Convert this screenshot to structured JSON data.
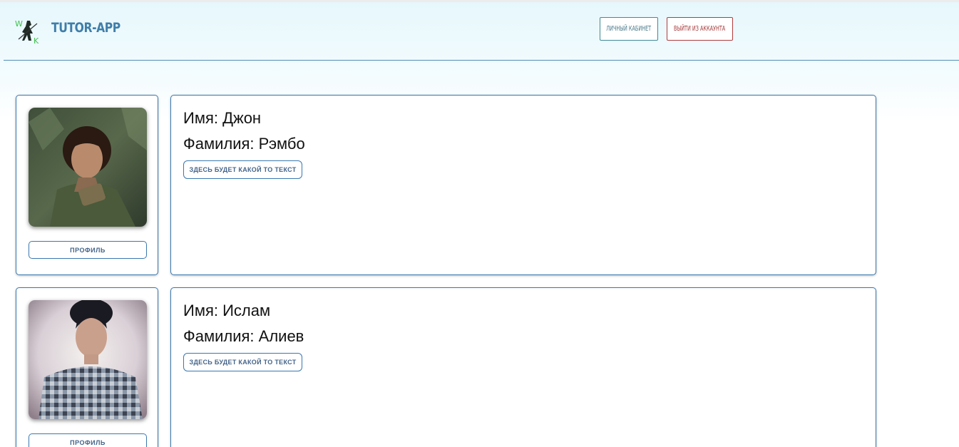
{
  "header": {
    "app_title": "TUTOR-APP",
    "logo_letters": [
      "W",
      "K"
    ],
    "cabinet_label": "Личный кабинет",
    "logout_label": "Выйти из аккаунта"
  },
  "colors": {
    "accent": "#3a78b0",
    "title": "#3f7ea9",
    "logout": "#b23b3b",
    "logo_green": "#3cc24a"
  },
  "tutors": [
    {
      "first_name_line": "Имя: Джон",
      "last_name_line": "Фамилия: Рэмбо",
      "info_button": "Здесь будет какой то текст",
      "profile_button": "Профиль",
      "photo_icon": "user-photo"
    },
    {
      "first_name_line": "Имя: Ислам",
      "last_name_line": "Фамилия: Алиев",
      "info_button": "Здесь будет какой то текст",
      "profile_button": "Профиль",
      "photo_icon": "user-photo"
    }
  ]
}
